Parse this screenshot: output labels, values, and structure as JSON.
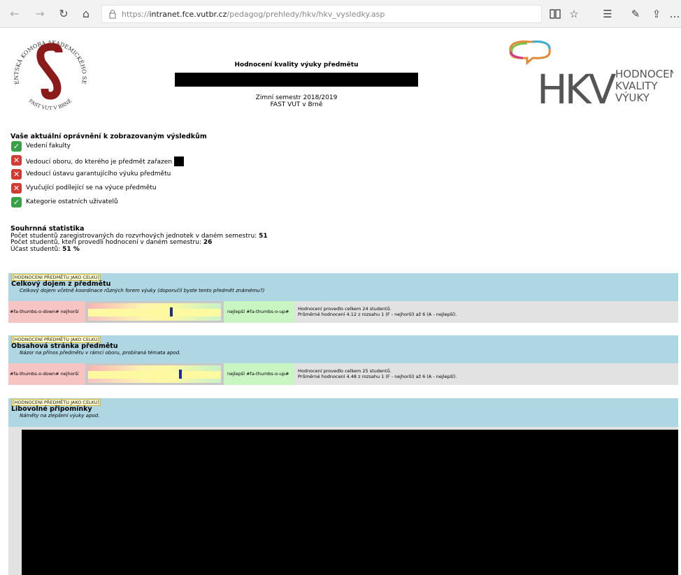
{
  "browser": {
    "url_prefix": "https://",
    "url_host": "intranet.fce.vutbr.cz",
    "url_path": "/pedagog/prehledy/hkv/hkv_vysledky.asp"
  },
  "header": {
    "seal_text_top": "STUDENTSKÁ KOMORA AKADEMICKÉHO SENÁTU",
    "seal_text_bottom": "FAST VUT V BRNĚ",
    "title": "Hodnocení kvality výuky předmětu",
    "semester": "Zimní semestr 2018/2019",
    "faculty": "FAST VUT v Brně",
    "logo_letters": "HKV",
    "logo_line1": "HODNOCENÍ",
    "logo_line2": "KVALITY",
    "logo_line3": "VÝUKY"
  },
  "permissions": {
    "title": "Vaše aktuální oprávnění k zobrazovaným výsledkům",
    "items": [
      {
        "label": "Vedení fakulty",
        "granted": true
      },
      {
        "label": "Vedoucí oboru, do kterého je předmět zařazen",
        "granted": false
      },
      {
        "label": "Vedoucí ústavu garantujícího výuku předmětu",
        "granted": false
      },
      {
        "label": "Vyučující podílející se na výuce předmětu",
        "granted": false
      },
      {
        "label": "Kategorie ostatních uživatelů",
        "granted": true
      }
    ]
  },
  "stats": {
    "title": "Souhrnná statistika",
    "registered_label": "Počet studentů zaregistrovaných do rozvrhových jednotek v daném semestru:",
    "registered_value": "51",
    "rated_label": "Počet studentů, kteří provedli hodnocení v daném semestru:",
    "rated_value": "26",
    "participation_label": "Účast studentů:",
    "participation_value": "51 %"
  },
  "sections": [
    {
      "tag": "[HODNOCENÍ PŘEDMĚTU JAKO CELKU]",
      "name": "Celkový dojem z předmětu",
      "desc": "Celkový dojem včetně koordinace různých forem výuky (doporučil byste tento předmět známému?)",
      "worst_label": "#fa-thumbs-o-down# nejhorší",
      "best_label": "nejlepší #fa-thumbs-o-up#",
      "info_line1": "Hodnocení provedlo celkem 24 studentů.",
      "info_line2": "Průměrné hodnocení 4.12 z rozsahu 1 (F - nejhorší) až 6 (A - nejlepší).",
      "average": 4.12
    },
    {
      "tag": "[HODNOCENÍ PŘEDMĚTU JAKO CELKU]",
      "name": "Obsahová stránka předmětu",
      "desc": "Názor na přínos předmětu v rámci oboru, probíraná témata apod.",
      "worst_label": "#fa-thumbs-o-down# nejhorší",
      "best_label": "nejlepší #fa-thumbs-o-up#",
      "info_line1": "Hodnocení provedlo celkem 25 studentů.",
      "info_line2": "Průměrné hodnocení 4.48 z rozsahu 1 (F - nejhorší) až 6 (A - nejlepší).",
      "average": 4.48
    },
    {
      "tag": "[HODNOCENÍ PŘEDMĚTU JAKO CELKU]",
      "name": "Libovolné připomínky",
      "desc": "Náměty na zlepšení výuky apod."
    }
  ],
  "colors": {
    "section_bg": "#aed7e3",
    "granted": "#3aa047",
    "denied": "#d23b34",
    "marker": "#1c2d92",
    "seal_red": "#8b1a1a",
    "hkv_gray": "#555555"
  },
  "icons": {
    "back": "arrow-left-icon",
    "forward": "arrow-right-icon",
    "refresh": "refresh-icon",
    "home": "home-icon",
    "lock": "lock-icon",
    "reading_view": "book-icon",
    "favorite": "star-icon",
    "favorites_hub": "favorites-list-icon",
    "notes": "pen-icon",
    "share": "share-icon",
    "more": "ellipsis-icon"
  }
}
